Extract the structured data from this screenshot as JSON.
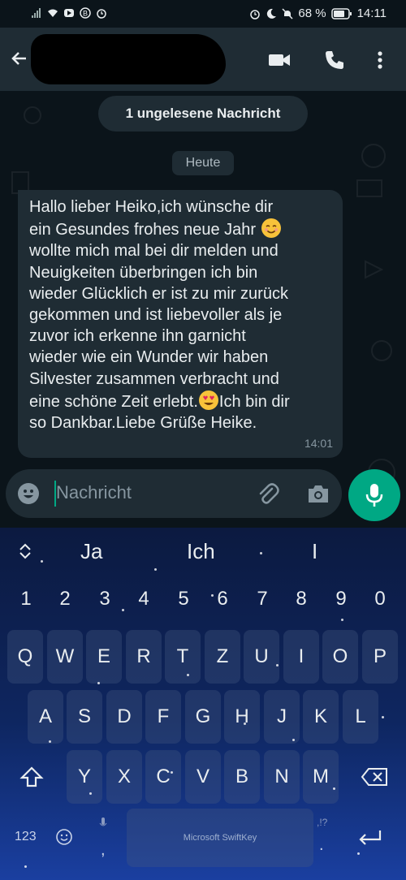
{
  "status_bar": {
    "battery": "68 %",
    "time": "14:11"
  },
  "header": {
    "contact_name": ""
  },
  "chat": {
    "unread_label": "1 ungelesene Nachricht",
    "date_label": "Heute",
    "message": {
      "lines": [
        "Hallo lieber Heiko,ich wünsche dir",
        "ein Gesundes frohes neue Jahr",
        "wollte mich mal bei dir melden und",
        "Neuigkeiten überbringen ich bin",
        "wieder Glücklich er ist zu mir zurück",
        "gekommen und ist liebevoller als je",
        "zuvor ich erkenne ihn garnicht",
        "wieder wie ein Wunder wir haben",
        "Silvester zusammen verbracht und",
        "eine schöne Zeit erlebt.",
        "so Dankbar.Liebe Grüße Heike."
      ],
      "line10_after_emoji": "Ich bin dir",
      "time": "14:01"
    }
  },
  "composer": {
    "placeholder": "Nachricht"
  },
  "keyboard": {
    "suggestions": [
      "Ja",
      "Ich",
      "I"
    ],
    "numbers": [
      "1",
      "2",
      "3",
      "4",
      "5",
      "6",
      "7",
      "8",
      "9",
      "0"
    ],
    "row1": [
      "Q",
      "W",
      "E",
      "R",
      "T",
      "Z",
      "U",
      "I",
      "O",
      "P"
    ],
    "row2": [
      "A",
      "S",
      "D",
      "F",
      "G",
      "H",
      "J",
      "K",
      "L"
    ],
    "row3": [
      "Y",
      "X",
      "C",
      "V",
      "B",
      "N",
      "M"
    ],
    "numbers_key": "123",
    "comma_key": ",",
    "period_key": ".",
    "punct_hint": ",!?",
    "space_label": "Microsoft SwiftKey"
  },
  "colors": {
    "accent": "#00a884",
    "bubble": "#1f2c34",
    "background": "#0b141a"
  }
}
